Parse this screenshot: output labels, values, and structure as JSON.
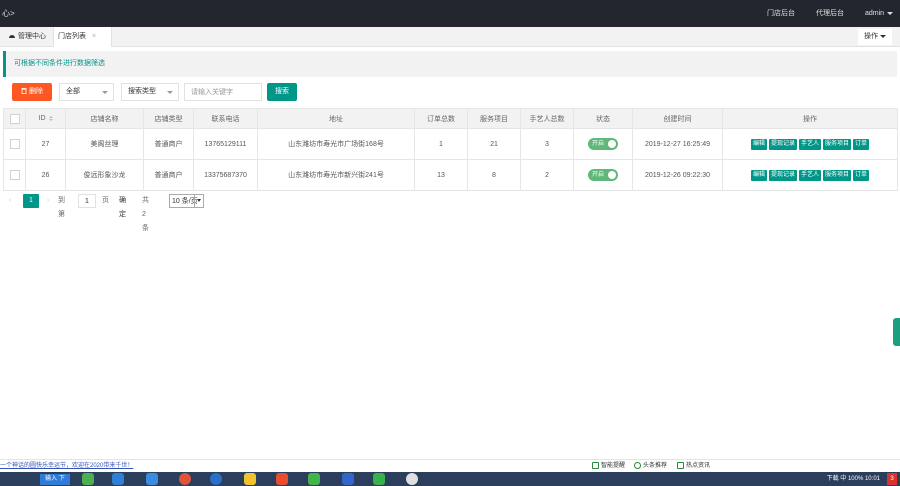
{
  "topbar": {
    "brand": "心>",
    "nav_items": [
      "门店后台",
      "代理后台"
    ],
    "user": "admin"
  },
  "tabs": {
    "home": "管理中心",
    "current": "门店列表",
    "close_glyph": "×",
    "ops_label": "操作"
  },
  "notice": "可根据不同条件进行数据筛选",
  "filters": {
    "delete_label": "删除",
    "select1": "全部",
    "select2": "搜索类型",
    "keyword_placeholder": "请输入关键字",
    "search_label": "搜索"
  },
  "table": {
    "headers": [
      "",
      "ID",
      "店铺名称",
      "店铺类型",
      "联系电话",
      "地址",
      "订单总数",
      "服务项目",
      "手艺人总数",
      "状态",
      "创建时间",
      "操作"
    ],
    "rows": [
      {
        "id": "27",
        "name": "美阁丝理",
        "type": "普通商户",
        "phone": "13765129111",
        "address": "山东潍坊市寿光市广场街168号",
        "orders": "1",
        "services": "21",
        "artisans": "3",
        "status": "开启",
        "created": "2019-12-27 16:25:49",
        "actions": [
          "编辑",
          "提现记录",
          "手艺人",
          "服务项目",
          "订单"
        ]
      },
      {
        "id": "26",
        "name": "俊远形象沙龙",
        "type": "普通商户",
        "phone": "13375687370",
        "address": "山东潍坊市寿光市新兴街241号",
        "orders": "13",
        "services": "8",
        "artisans": "2",
        "status": "开启",
        "created": "2019-12-26 09:22:30",
        "actions": [
          "编辑",
          "提现记录",
          "手艺人",
          "服务项目",
          "订单"
        ]
      }
    ]
  },
  "pager": {
    "prev": "‹",
    "current": "1",
    "next": "›",
    "goto_label": "到第",
    "goto_value": "1",
    "page_unit": "页",
    "confirm": "确定",
    "total": "共 2 条",
    "page_size": "10 条/页"
  },
  "bottom": {
    "ticker": "一个神话的圆快乐幸运节，欢迎在2020带来千世！",
    "tray": [
      "智能提醒",
      "头条推荐",
      "热点资讯"
    ],
    "taskbar_start": "输入 下",
    "taskbar_right": "下载  中  100%  10:01",
    "badge": "3"
  },
  "colors": {
    "accent": "#009688",
    "danger": "#ff5722",
    "switch_on": "#5fb878",
    "topbar": "#23262e"
  }
}
